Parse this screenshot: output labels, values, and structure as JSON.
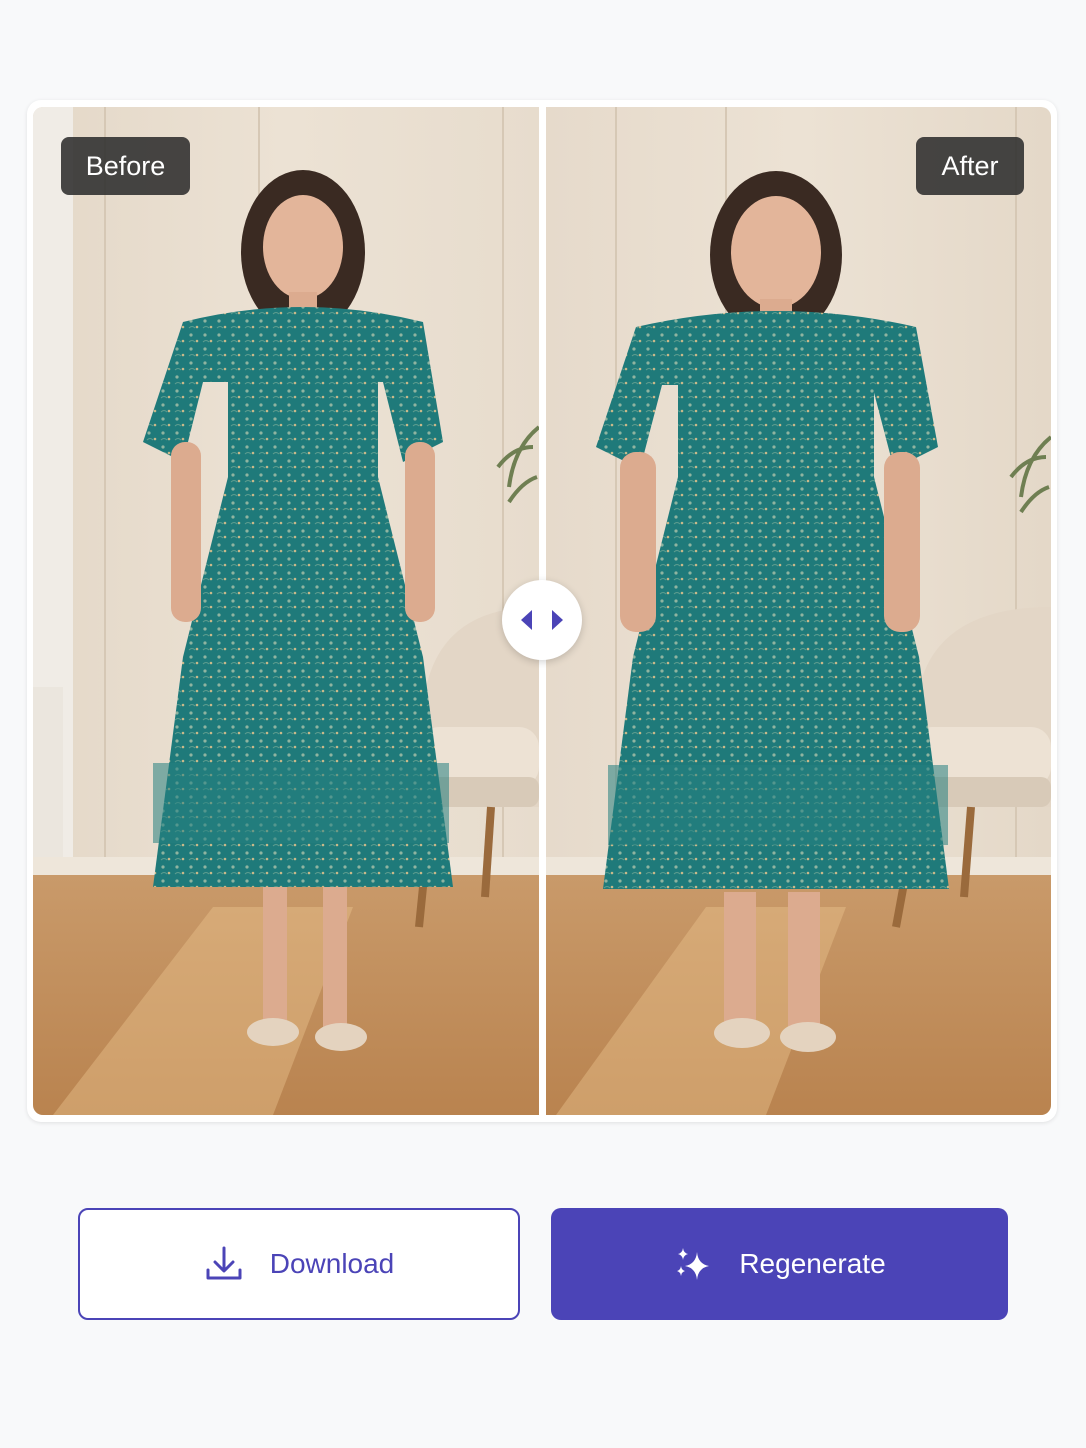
{
  "comparison": {
    "before_label": "Before",
    "after_label": "After",
    "handle_icon": "left-right-arrows-icon"
  },
  "actions": {
    "download_label": "Download",
    "download_icon": "download-icon",
    "regenerate_label": "Regenerate",
    "regenerate_icon": "sparkle-icon"
  },
  "colors": {
    "accent": "#4b44b7",
    "background": "#f8f9fa",
    "tag_background": "#2d2d2d"
  }
}
